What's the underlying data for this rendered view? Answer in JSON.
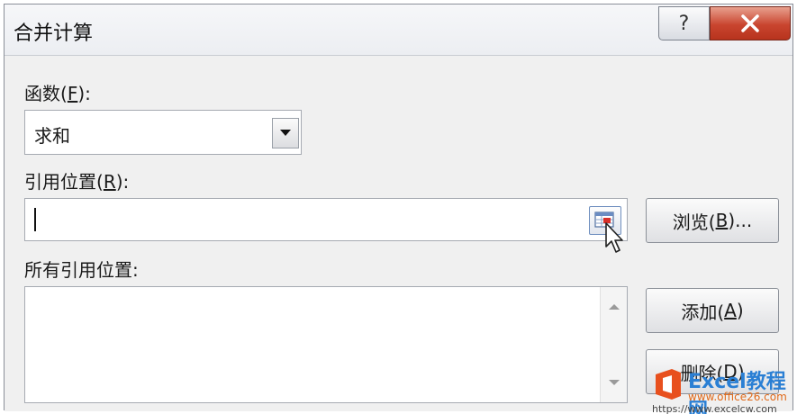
{
  "window": {
    "title": "合并计算",
    "help_label": "?",
    "close_label": "X"
  },
  "function_field": {
    "label_prefix": "函数(",
    "label_key": "F",
    "label_suffix": "):",
    "value": "求和"
  },
  "reference_field": {
    "label_prefix": "引用位置(",
    "label_key": "R",
    "label_suffix": "):",
    "value": ""
  },
  "browse_button": {
    "prefix": "浏览(",
    "key": "B",
    "suffix": ")..."
  },
  "all_references": {
    "label": "所有引用位置:"
  },
  "add_button": {
    "prefix": "添加(",
    "key": "A",
    "suffix": ")"
  },
  "delete_button": {
    "prefix": "删除(",
    "key": "D",
    "suffix": ")"
  },
  "watermark": {
    "brand": "Excel教程网",
    "site1": "www.office26.com",
    "site2": "https://www.excelcw.com"
  },
  "colors": {
    "close_red": "#c9452f",
    "accent_blue": "#2a7fd4"
  }
}
